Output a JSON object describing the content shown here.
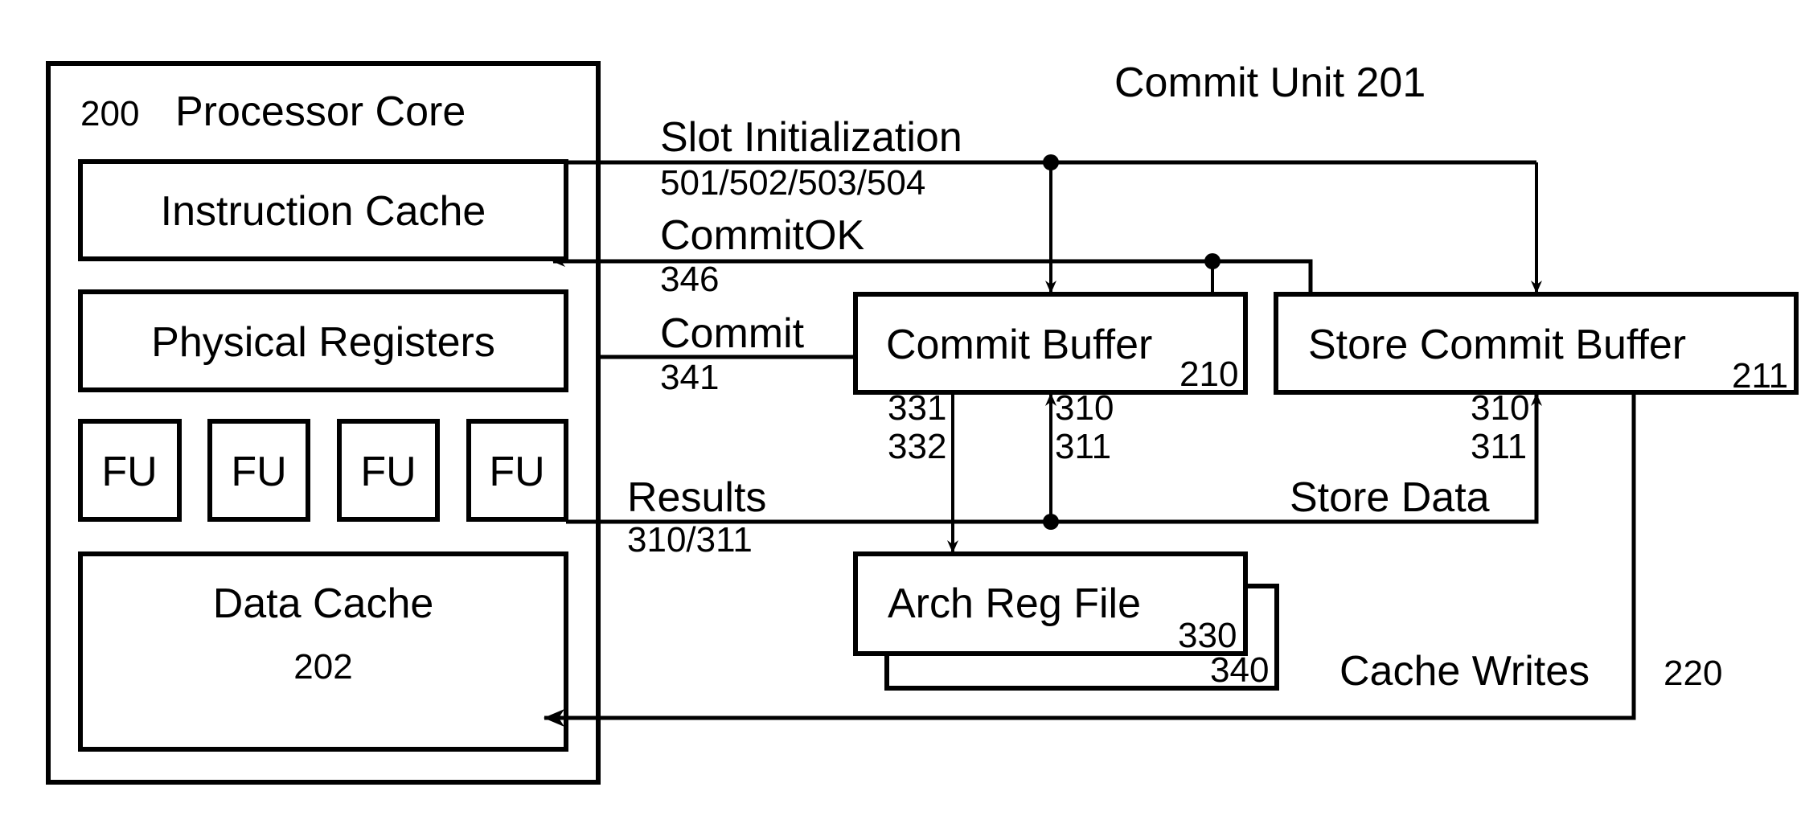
{
  "diagram": {
    "processor_core": {
      "number": "200",
      "title": "Processor Core",
      "instruction_cache": "Instruction Cache",
      "physical_registers": "Physical Registers",
      "functional_units": [
        "FU",
        "FU",
        "FU",
        "FU"
      ],
      "data_cache": {
        "title": "Data Cache",
        "number": "202"
      }
    },
    "commit_unit": {
      "title": "Commit Unit 201",
      "commit_buffer": {
        "title": "Commit Buffer",
        "number": "210"
      },
      "store_commit_buffer": {
        "title": "Store Commit Buffer",
        "number": "211"
      },
      "arch_reg_file": {
        "title": "Arch Reg File",
        "number": "330",
        "shadow_number": "340"
      }
    },
    "signals": {
      "slot_init": {
        "label": "Slot Initialization",
        "number": "501/502/503/504"
      },
      "commit_ok": {
        "label": "CommitOK",
        "number": "346"
      },
      "commit": {
        "label": "Commit",
        "number": "341"
      },
      "results": {
        "label": "Results",
        "number": "310/311"
      },
      "arch_write": {
        "line1": "331",
        "line2": "332"
      },
      "results_to_cb": {
        "line1": "310",
        "line2": "311"
      },
      "results_to_scb": {
        "line1": "310",
        "line2": "311"
      },
      "store_data": {
        "label": "Store Data"
      },
      "cache_writes": {
        "label": "Cache Writes",
        "number": "220"
      }
    }
  }
}
